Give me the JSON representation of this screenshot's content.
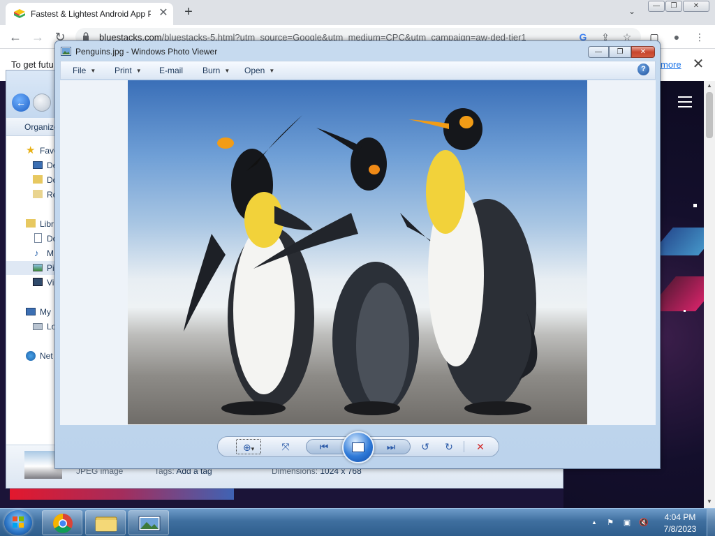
{
  "browser": {
    "tab_title": "Fastest & Lightest Android App Player",
    "tab_close": "✕",
    "new_tab": "+",
    "tab_dropdown": "⌄",
    "window_controls": {
      "minimize": "—",
      "restore": "❐",
      "close": "✕"
    },
    "back": "←",
    "forward": "→",
    "reload": "↻",
    "url_host": "bluestacks.com",
    "url_path": "/bluestacks-5.html?utm_source=Google&utm_medium=CPC&utm_campaign=aw-ded-tier1",
    "toolbar_icons": {
      "google": "G",
      "share": "⇪",
      "star": "☆",
      "sidebar": "▢",
      "profile": "●",
      "menu": "⋮"
    }
  },
  "infobar": {
    "message": "To get futu",
    "link": "more",
    "close": "✕"
  },
  "explorer": {
    "back": "←",
    "organize_label": "Organize",
    "nav": [
      {
        "label": "Favo",
        "icon": "star-icon"
      },
      {
        "label": "De",
        "icon": "desktop-icon"
      },
      {
        "label": "Do",
        "icon": "downloads-icon"
      },
      {
        "label": "Re",
        "icon": "recent-icon"
      },
      {
        "label": "Libr",
        "icon": "library-icon"
      },
      {
        "label": "Do",
        "icon": "documents-icon"
      },
      {
        "label": "M",
        "icon": "music-icon"
      },
      {
        "label": "Pi",
        "icon": "pictures-icon"
      },
      {
        "label": "Vi",
        "icon": "videos-icon"
      },
      {
        "label": "My",
        "icon": "computer-icon"
      },
      {
        "label": "Lo",
        "icon": "local-disk-icon"
      },
      {
        "label": "Net",
        "icon": "network-icon"
      }
    ],
    "details": {
      "type": "JPEG image",
      "tags_label": "Tags:",
      "tags_value": "Add a tag",
      "dimensions_label": "Dimensions:",
      "dimensions_value": "1024 x 768"
    }
  },
  "viewer": {
    "title": "Penguins.jpg - Windows Photo Viewer",
    "window_controls": {
      "minimize": "—",
      "restore": "❐",
      "close": "✕"
    },
    "menu": [
      {
        "label": "File",
        "dropdown": true
      },
      {
        "label": "Print",
        "dropdown": true
      },
      {
        "label": "E-mail",
        "dropdown": false
      },
      {
        "label": "Burn",
        "dropdown": true
      },
      {
        "label": "Open",
        "dropdown": true
      }
    ],
    "menu_caret": "▼",
    "help": "?",
    "photo_alt": "Penguins",
    "controls": {
      "zoom": "⊕",
      "zoom_caret": "▾",
      "actual_size": "⤧",
      "previous": "⏮",
      "next": "⏭",
      "rotate_ccw": "↺",
      "rotate_cw": "↻",
      "delete": "✕"
    }
  },
  "taskbar": {
    "time": "4:04 PM",
    "date": "7/8/2023",
    "tray_icons": {
      "show_hidden": "▲",
      "action_center": "⚑",
      "network": "▣",
      "volume": "🔇"
    }
  }
}
